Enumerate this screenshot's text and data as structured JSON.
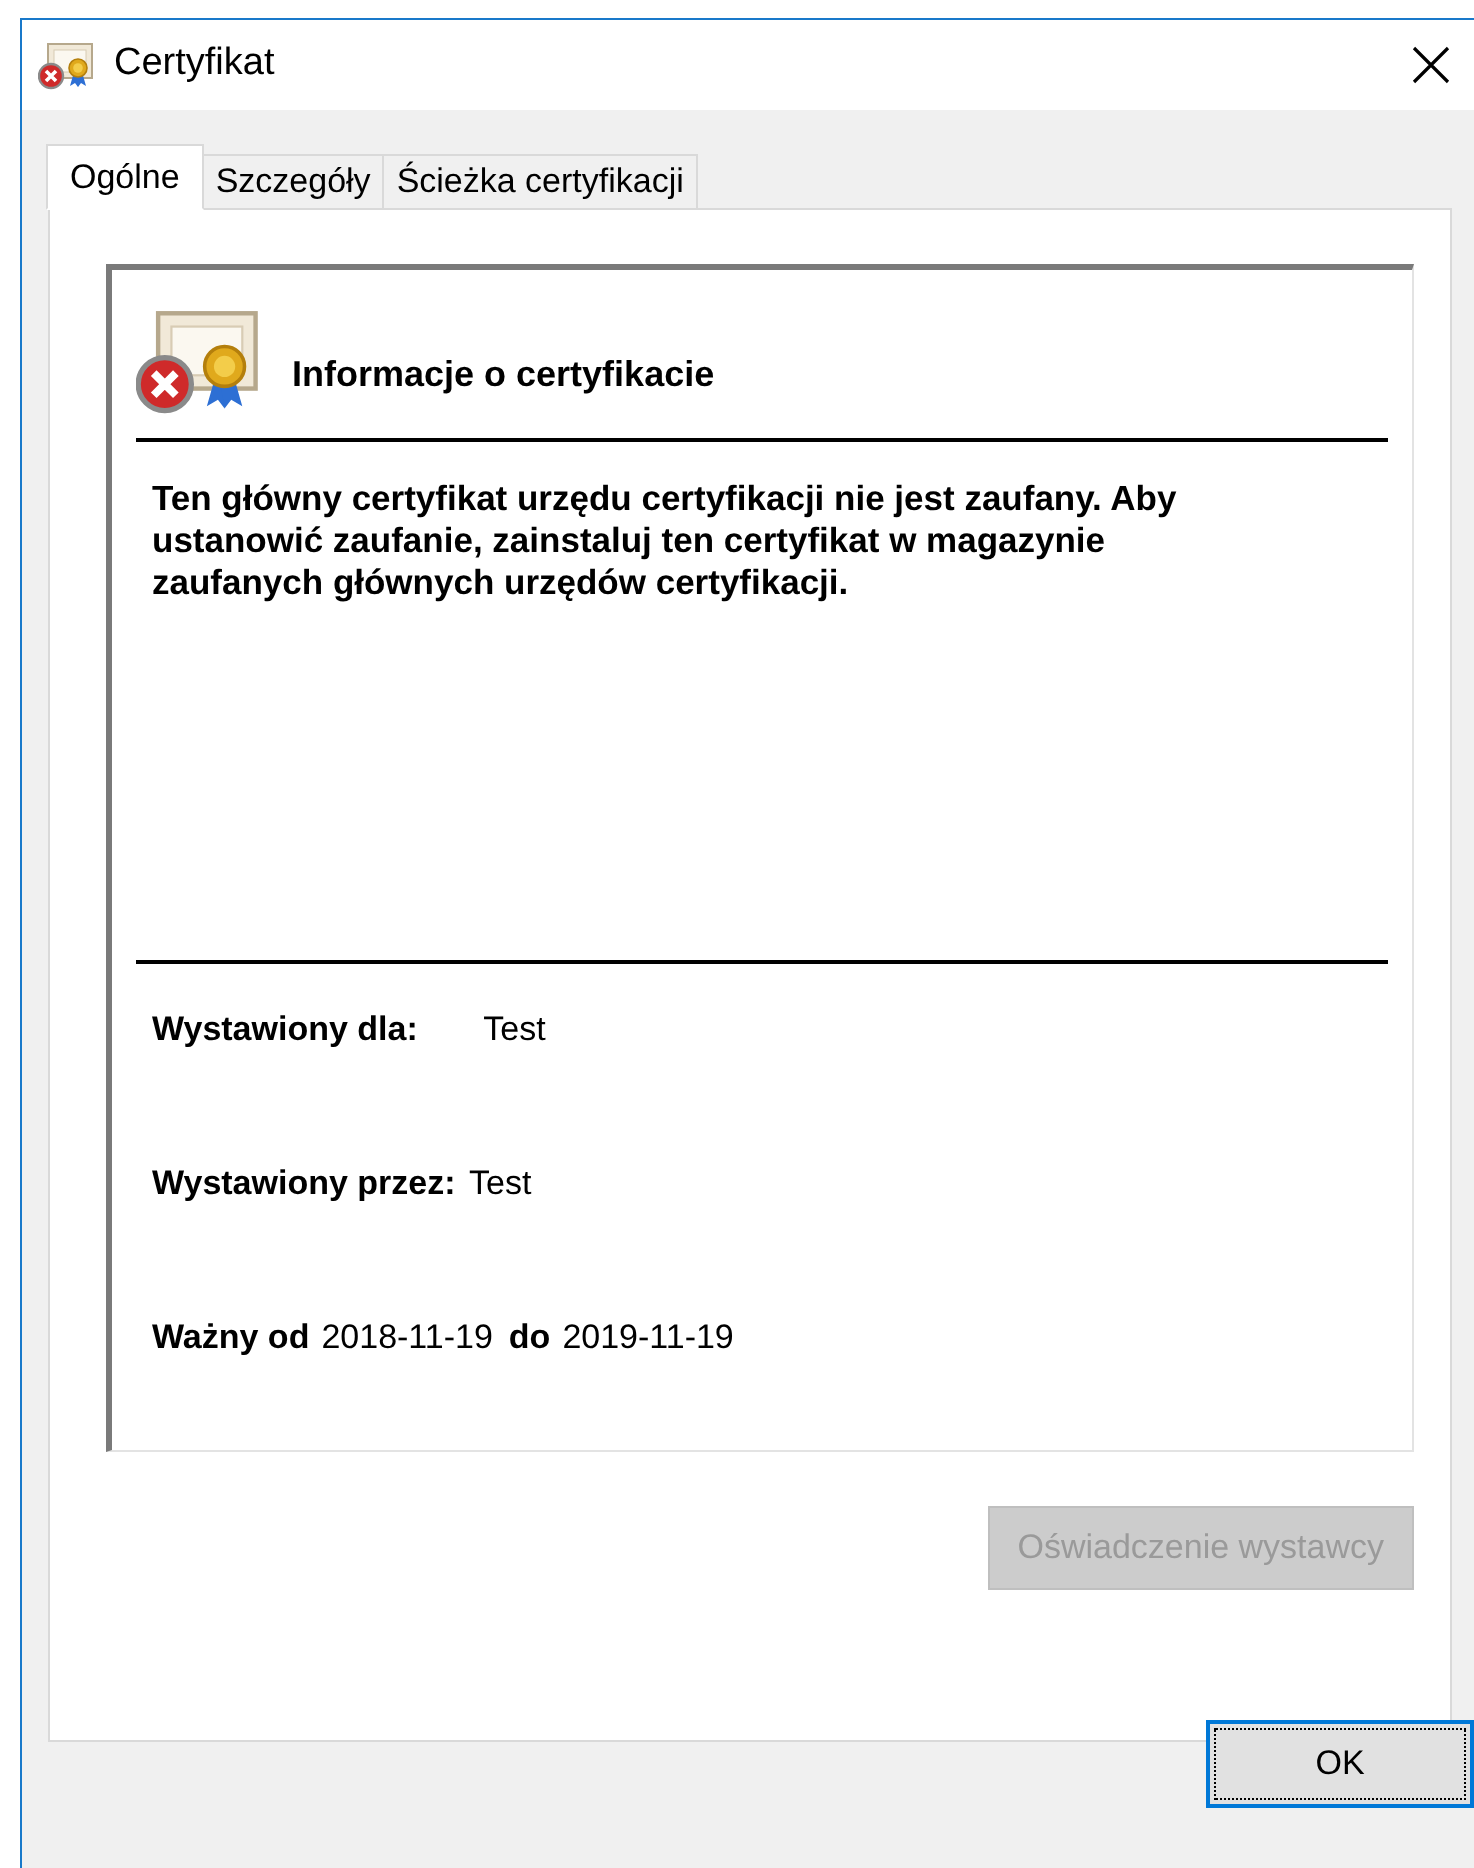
{
  "window": {
    "title": "Certyfikat"
  },
  "tabs": [
    {
      "label": "Ogólne",
      "selected": true
    },
    {
      "label": "Szczegóły",
      "selected": false
    },
    {
      "label": "Ścieżka certyfikacji",
      "selected": false
    }
  ],
  "info": {
    "heading": "Informacje o certyfikacie",
    "message": "Ten główny certyfikat urzędu certyfikacji nie jest zaufany. Aby ustanowić zaufanie, zainstaluj ten certyfikat w magazynie zaufanych głównych urzędów certyfikacji.",
    "trusted": false
  },
  "fields": [
    {
      "label": "Wystawiony dla:",
      "value": "Test"
    },
    {
      "label": "Wystawiony przez:",
      "value": "Test"
    }
  ],
  "validity": {
    "from_label": "Ważny od",
    "from": "2018-11-19",
    "to_label": "do",
    "to": "2019-11-19"
  },
  "issuer_button": {
    "label": "Oświadczenie wystawcy",
    "disabled": true
  },
  "ok_button": {
    "label": "OK",
    "focused": true
  }
}
